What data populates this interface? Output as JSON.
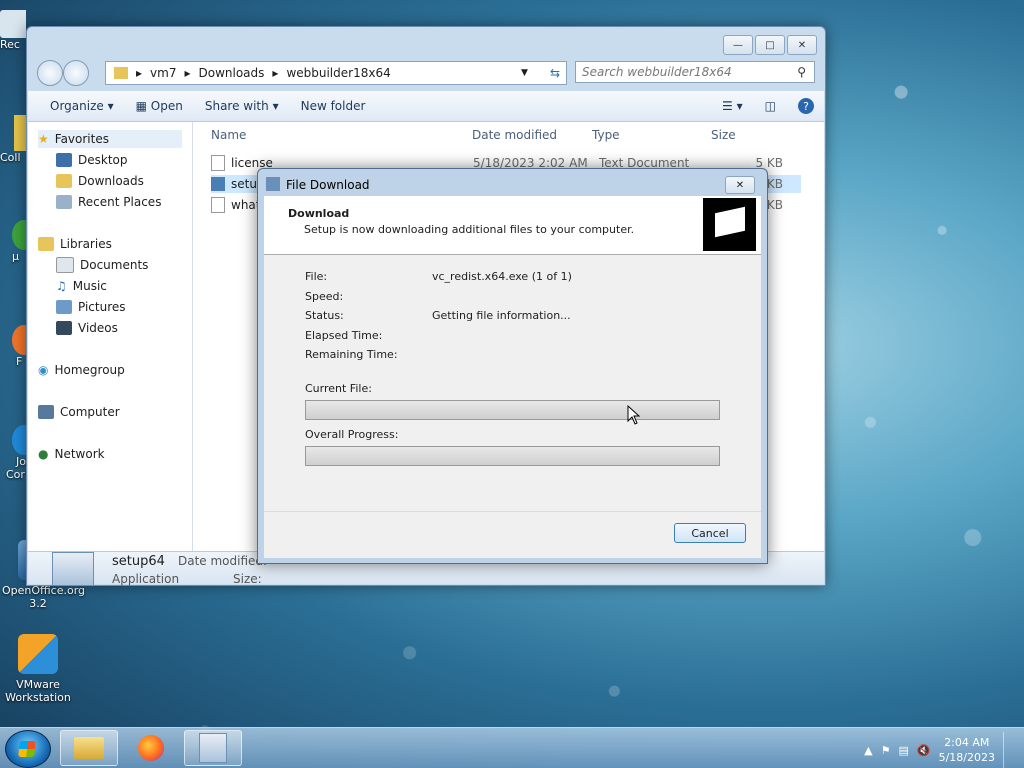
{
  "desktop": {
    "icons": [
      {
        "label": "OpenOffice.org 3.2"
      },
      {
        "label": "VMware Workstation"
      }
    ],
    "edge_labels": [
      "Rec",
      "Coll",
      "μ",
      "F",
      "Jo",
      "Cor"
    ]
  },
  "explorer": {
    "breadcrumb": [
      "vm7",
      "Downloads",
      "webbuilder18x64"
    ],
    "search_placeholder": "Search webbuilder18x64",
    "toolbar": {
      "organize": "Organize",
      "open": "Open",
      "share_with": "Share with",
      "new_folder": "New folder"
    },
    "sidebar": {
      "favorites": "Favorites",
      "favorites_items": [
        "Desktop",
        "Downloads",
        "Recent Places"
      ],
      "libraries": "Libraries",
      "libraries_items": [
        "Documents",
        "Music",
        "Pictures",
        "Videos"
      ],
      "homegroup": "Homegroup",
      "computer": "Computer",
      "network": "Network"
    },
    "columns": {
      "name": "Name",
      "date": "Date modified",
      "type": "Type",
      "size": "Size"
    },
    "files": [
      {
        "name": "license",
        "date": "5/18/2023 2:02 AM",
        "type": "Text Document",
        "size": "5 KB"
      },
      {
        "name": "setup",
        "date": "",
        "type": "",
        "size": "KB"
      },
      {
        "name": "what",
        "date": "",
        "type": "",
        "size": "KB"
      }
    ],
    "details": {
      "name": "setup64",
      "type": "Application",
      "date_label": "Date modified:",
      "size_label": "Size:"
    }
  },
  "dialog": {
    "title": "File Download",
    "heading": "Download",
    "subheading": "Setup is now downloading additional files to your computer.",
    "fields": [
      {
        "label": "File:",
        "value": "vc_redist.x64.exe (1 of 1)"
      },
      {
        "label": "Speed:",
        "value": ""
      },
      {
        "label": "Status:",
        "value": "Getting file information..."
      },
      {
        "label": "Elapsed Time:",
        "value": ""
      },
      {
        "label": "Remaining Time:",
        "value": ""
      }
    ],
    "current_file_label": "Current File:",
    "overall_label": "Overall Progress:",
    "current_progress": 0,
    "overall_progress": 0,
    "cancel": "Cancel"
  },
  "taskbar": {
    "time": "2:04 AM",
    "date": "5/18/2023"
  }
}
